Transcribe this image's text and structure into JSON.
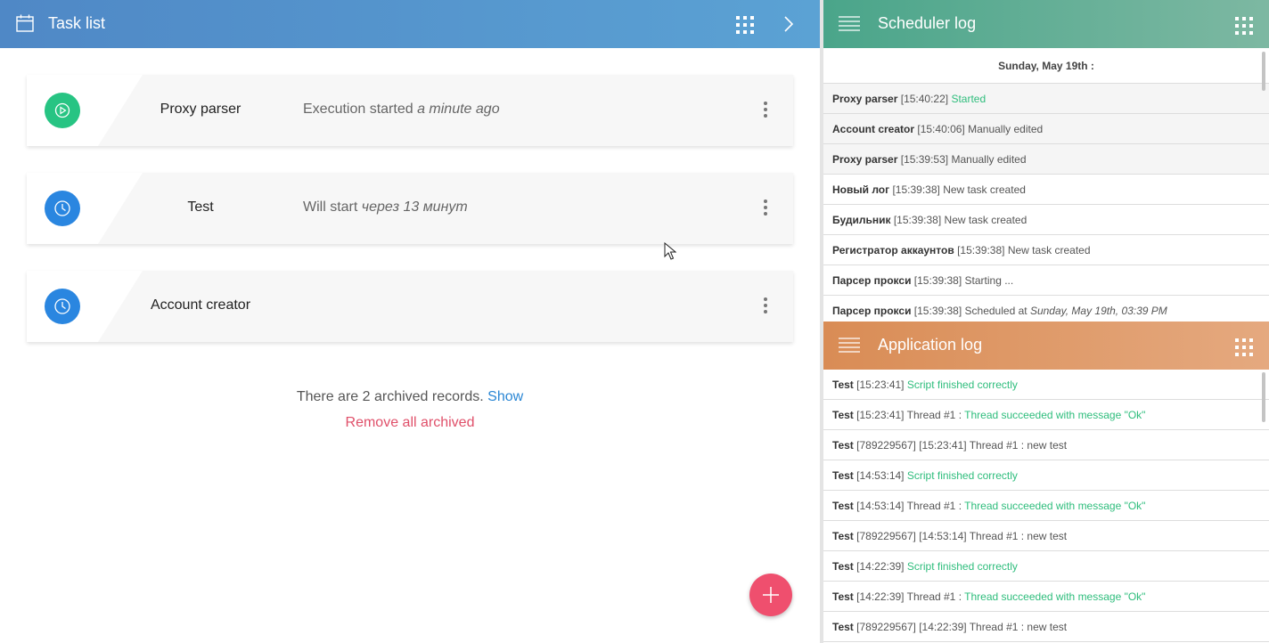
{
  "task_list": {
    "title": "Task list",
    "tasks": [
      {
        "name": "Proxy parser",
        "status_prefix": "Execution started",
        "status_time": "a minute ago",
        "icon": "play-icon",
        "color": "#27c483"
      },
      {
        "name": "Test",
        "status_prefix": "Will start",
        "status_time": "через 13 минут",
        "icon": "clock-icon",
        "color": "#2a86e0"
      },
      {
        "name": "Account creator",
        "status_prefix": "",
        "status_time": "",
        "icon": "clock-icon",
        "color": "#2a86e0"
      }
    ],
    "archive_text": "There are 2 archived records.",
    "archive_show": "Show",
    "remove_archived": "Remove all archived"
  },
  "scheduler_log": {
    "title": "Scheduler log",
    "date": "Sunday, May 19th :",
    "rows": [
      {
        "name": "Proxy parser",
        "time": "[15:40:22]",
        "msg": "",
        "green": "Started"
      },
      {
        "name": "Account creator",
        "time": "[15:40:06]",
        "msg": "Manually edited",
        "green": ""
      },
      {
        "name": "Proxy parser",
        "time": "[15:39:53]",
        "msg": "Manually edited",
        "green": ""
      },
      {
        "name": "Новый лог",
        "time": "[15:39:38]",
        "msg": "New task created",
        "green": ""
      },
      {
        "name": "Будильник",
        "time": "[15:39:38]",
        "msg": "New task created",
        "green": ""
      },
      {
        "name": "Регистратор аккаунтов",
        "time": "[15:39:38]",
        "msg": "New task created",
        "green": ""
      },
      {
        "name": "Парсер прокси",
        "time": "[15:39:38]",
        "msg": "Starting ...",
        "green": ""
      },
      {
        "name": "Парсер прокси",
        "time": "[15:39:38]",
        "msg": "Scheduled at",
        "em": "Sunday, May 19th, 03:39 PM"
      }
    ]
  },
  "application_log": {
    "title": "Application log",
    "rows": [
      {
        "name": "Test",
        "time": "[15:23:41]",
        "msg": "",
        "green": "Script finished correctly"
      },
      {
        "name": "Test",
        "time": "[15:23:41]",
        "msg": "Thread #1 :",
        "green": "Thread succeeded with message \"Ok\""
      },
      {
        "name": "Test",
        "time": "[789229567] [15:23:41]",
        "msg": "Thread #1 : new test",
        "green": ""
      },
      {
        "name": "Test",
        "time": "[14:53:14]",
        "msg": "",
        "green": "Script finished correctly"
      },
      {
        "name": "Test",
        "time": "[14:53:14]",
        "msg": "Thread #1 :",
        "green": "Thread succeeded with message \"Ok\""
      },
      {
        "name": "Test",
        "time": "[789229567] [14:53:14]",
        "msg": "Thread #1 : new test",
        "green": ""
      },
      {
        "name": "Test",
        "time": "[14:22:39]",
        "msg": "",
        "green": "Script finished correctly"
      },
      {
        "name": "Test",
        "time": "[14:22:39]",
        "msg": "Thread #1 :",
        "green": "Thread succeeded with message \"Ok\""
      },
      {
        "name": "Test",
        "time": "[789229567] [14:22:39]",
        "msg": "Thread #1 : new test",
        "green": ""
      }
    ]
  },
  "colors": {
    "task_header": "#4f88c6",
    "scheduler_header": "#4aa58a",
    "app_header": "#d98c55",
    "fab": "#ef4f6e",
    "success_text": "#2ebd7c",
    "link": "#2a86d4",
    "danger_link": "#e0506a"
  }
}
